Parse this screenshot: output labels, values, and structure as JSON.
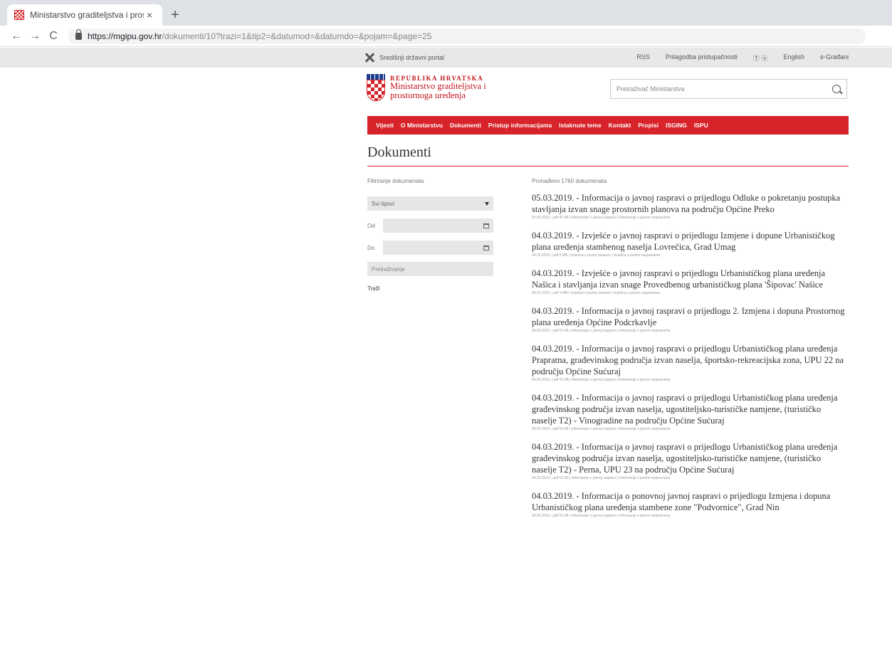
{
  "browser": {
    "tab_title": "Ministarstvo graditeljstva i prost",
    "close_glyph": "×",
    "newtab_glyph": "+",
    "back_glyph": "←",
    "forward_glyph": "→",
    "reload_glyph": "C",
    "url_host": "https://mgipu.gov.hr",
    "url_path": "/dokumenti/10?trazi=1&tip2=&datumod=&datumdo=&pojam=&page=25"
  },
  "topbar": {
    "left_text": "Središnji državni portal",
    "links": [
      "RSS",
      "Prilagodba pristupačnosti",
      "Ⓣ ⓐ",
      "English",
      "e-Građani"
    ]
  },
  "brand": {
    "country": "REPUBLIKA HRVATSKA",
    "ministry": "Ministarstvo graditeljstva i prostornoga uređenja"
  },
  "search": {
    "placeholder": "Pretraživač Ministarstva"
  },
  "mainnav": [
    "Vijesti",
    "O Ministarstvu",
    "Dokumenti",
    "Pristup informacijama",
    "Istaknute teme",
    "Kontakt",
    "Propisi",
    "ISGING",
    "ISPU"
  ],
  "page_title": "Dokumenti",
  "filter": {
    "heading": "Filtriranje dokumenata",
    "type_select": "Svi tipovi",
    "from_label": "Od",
    "to_label": "Do",
    "search_placeholder": "Pretraživanje",
    "submit": "Traži"
  },
  "result_count": "Pronađeno 1760 dokumenata",
  "results": [
    {
      "title": "05.03.2019. - Informacija o javnoj raspravi o prijedlogu Odluke o pokretanju postupka stavljanja izvan snage prostornih planova na području Općine Preko",
      "meta": "05.03.2019. | pdf 47 kB | Informacije o javnoj raspravi | Informacije o javnim raspravama"
    },
    {
      "title": "04.03.2019. - Izvješće o javnoj raspravi o prijedlogu Izmjene i dopune Urbanističkog plana uređenja stambenog naselja Lovrečica, Grad Umag",
      "meta": "04.03.2019. | pdf 8 MB | Izvješća o javnoj raspravi | Izvješća o javnim raspravama"
    },
    {
      "title": "04.03.2019. - Izvješće o javnoj raspravi o prijedlogu Urbanističkog plana uređenja Našica i stavljanja izvan snage Provedbenog urbanističkog plana 'Šipovac' Našice",
      "meta": "04.03.2019. | pdf 4 MB | Izvješća o javnoj raspravi | Izvješća o javnim raspravama"
    },
    {
      "title": "04.03.2019. - Informacija o javnoj raspravi o prijedlogu 2. Izmjena i dopuna Prostornog plana uređenja Općine Podcrkavlje",
      "meta": "04.03.2019. | pdf 51 kB | Informacije o javnoj raspravi | Informacije o javnim raspravama"
    },
    {
      "title": "04.03.2019. - Informacija o javnoj raspravi o prijedlogu Urbanističkog plana uređenja Prapratna, građevinskog područja izvan naselja, športsko-rekreacijska zona, UPU 22 na području Općine Sućuraj",
      "meta": "04.03.2019. | pdf 52 kB | Informacije o javnoj raspravi | Informacije o javnim raspravama"
    },
    {
      "title": "04.03.2019. - Informacija o javnoj raspravi o prijedlogu Urbanističkog plana uređenja građevinskog područja izvan naselja, ugostiteljsko-turističke namjene, (turističko naselje T2) - Vinogradine na području Općine Sućuraj",
      "meta": "04.03.2019. | pdf 52 kB | Informacije o javnoj raspravi | Informacije o javnim raspravama"
    },
    {
      "title": "04.03.2019. - Informacija o javnoj raspravi o prijedlogu Urbanističkog plana uređenja građevinskog područja izvan naselja, ugostiteljsko-turističke namjene, (turističko naselje T2) - Perna, UPU 23 na području Općine Sućuraj",
      "meta": "04.03.2019. | pdf 52 kB | Informacije o javnoj raspravi | Informacije o javnim raspravama"
    },
    {
      "title": "04.03.2019. - Informacija o ponovnoj javnoj raspravi o prijedlogu Izmjena i dopuna Urbanističkog plana uređenja stambene zone \"Podvornice\", Grad Nin",
      "meta": "04.03.2019. | pdf 52 kB | Informacije o javnoj raspravi | Informacije o javnim raspravama"
    }
  ],
  "colors": {
    "brand_red": "#d8232a"
  }
}
